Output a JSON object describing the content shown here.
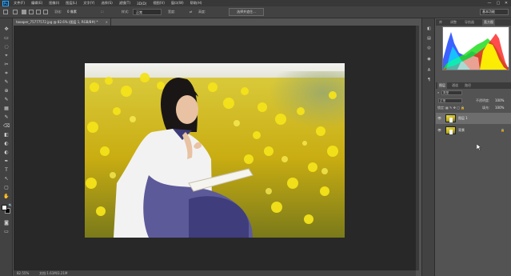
{
  "app": {
    "logo": "Ps",
    "menu": [
      "文件(F)",
      "编辑(E)",
      "图像(I)",
      "图层(L)",
      "文字(Y)",
      "选择(S)",
      "滤镜(T)",
      "3D(D)",
      "视图(V)",
      "窗口(W)",
      "帮助(H)"
    ],
    "window_buttons": [
      "—",
      "▢",
      "✕"
    ]
  },
  "options_bar": {
    "feather_label": "羽化:",
    "feather_value": "0 像素",
    "style_label": "样式:",
    "style_value": "正常",
    "width_label": "宽度:",
    "height_label": "高度:",
    "select_mask_button": "选择并遮住...",
    "workspace": "基本功能"
  },
  "document": {
    "tab_title": "toooper_75777572.jpg @ 82.6% (图层 1, RGB/8#) *",
    "tab_close": "×",
    "status_zoom": "82.55%",
    "status_doc": "文档:1.61M/3.21M"
  },
  "tools": [
    "▭",
    "✥",
    "⌖",
    "◌",
    "✂",
    "⌗",
    "✎",
    "⊕",
    "▦",
    "⌫",
    "◧",
    "◐",
    "✒",
    "T",
    "↖",
    "▢",
    "✋",
    "🔍",
    "⋯"
  ],
  "panel_strip": [
    "◧",
    "▤",
    "◎",
    "A",
    "¶"
  ],
  "histogram_panel": {
    "tabs": [
      "库",
      "调整",
      "导航器",
      "直方图"
    ],
    "colors": {
      "red": "#ff2020",
      "green": "#22dd22",
      "blue": "#2850ff",
      "yellow": "#ffff00",
      "cyan": "#00ffff"
    }
  },
  "layers_panel": {
    "tabs": [
      "图层",
      "通道",
      "路径"
    ],
    "filter_label": "类型",
    "blend_mode": "正常",
    "opacity_label": "不透明度:",
    "opacity_value": "100%",
    "lock_label": "锁定:",
    "fill_label": "填充:",
    "fill_value": "100%",
    "layers": [
      {
        "name": "图层 1",
        "selected": true,
        "locked": false
      },
      {
        "name": "背景",
        "selected": false,
        "locked": true
      }
    ],
    "footer_icons": [
      "∞",
      "fx",
      "◫",
      "◐",
      "▭",
      "▤",
      "🗑"
    ]
  }
}
